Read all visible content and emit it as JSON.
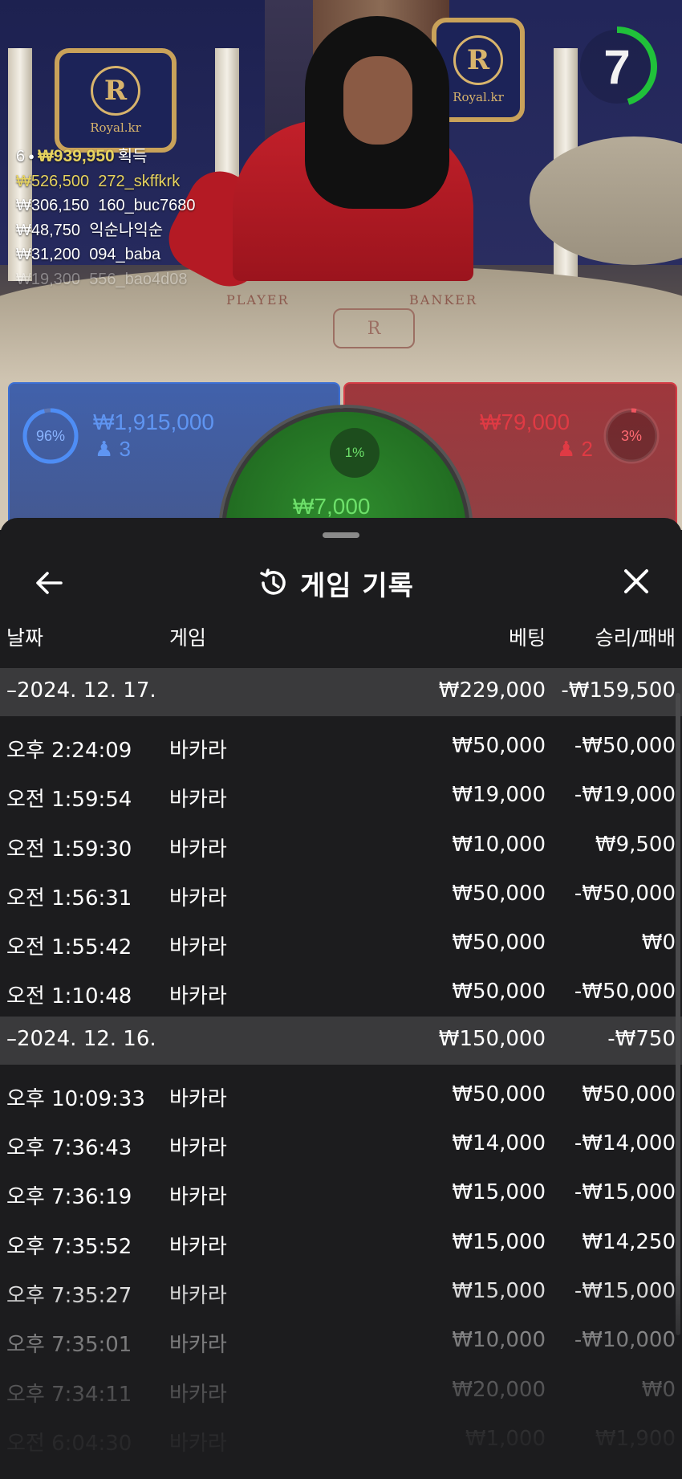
{
  "table": {
    "brand": "Royal.kr",
    "logo_letter": "R",
    "felt_player": "PLAYER",
    "felt_banker": "BANKER"
  },
  "timer": {
    "seconds": "7",
    "progress": 0.45
  },
  "winners": {
    "player_count": "6",
    "total_amount": "₩939,950",
    "total_suffix": "획득",
    "list": [
      {
        "amount": "₩526,500",
        "user": "272_skffkrk"
      },
      {
        "amount": "₩306,150",
        "user": "160_buc7680"
      },
      {
        "amount": "₩48,750",
        "user": "익순나익순"
      },
      {
        "amount": "₩31,200",
        "user": "094_baba"
      },
      {
        "amount": "₩19,300",
        "user": "556_bao4d08"
      }
    ]
  },
  "bets": {
    "player": {
      "percent": "96%",
      "amount": "₩1,915,000",
      "count": "3"
    },
    "banker": {
      "percent": "3%",
      "amount": "₩79,000",
      "count": "2"
    },
    "tie": {
      "percent": "1%",
      "amount": "₩7,000"
    }
  },
  "colors": {
    "player": "#3c6fd4",
    "banker": "#d63b45",
    "tie": "#2f8d2e",
    "winner_gold": "#e7d35f",
    "timer_green": "#20c13a"
  },
  "history": {
    "title": "게임 기록",
    "icons": {
      "back": "back-arrow-icon",
      "history": "history-icon",
      "close": "close-icon"
    },
    "columns": {
      "date": "날짜",
      "game": "게임",
      "bet": "베팅",
      "winloss": "승리/패배"
    },
    "groups": [
      {
        "date": "–2024. 12. 17.",
        "bet": "₩229,000",
        "winloss": "-₩159,500",
        "rows": [
          {
            "time": "오후 2:24:09",
            "game": "바카라",
            "bet": "₩50,000",
            "winloss": "-₩50,000"
          },
          {
            "time": "오전 1:59:54",
            "game": "바카라",
            "bet": "₩19,000",
            "winloss": "-₩19,000"
          },
          {
            "time": "오전 1:59:30",
            "game": "바카라",
            "bet": "₩10,000",
            "winloss": "₩9,500"
          },
          {
            "time": "오전 1:56:31",
            "game": "바카라",
            "bet": "₩50,000",
            "winloss": "-₩50,000"
          },
          {
            "time": "오전 1:55:42",
            "game": "바카라",
            "bet": "₩50,000",
            "winloss": "₩0"
          },
          {
            "time": "오전 1:10:48",
            "game": "바카라",
            "bet": "₩50,000",
            "winloss": "-₩50,000"
          }
        ]
      },
      {
        "date": "–2024. 12. 16.",
        "bet": "₩150,000",
        "winloss": "-₩750",
        "rows": [
          {
            "time": "오후 10:09:33",
            "game": "바카라",
            "bet": "₩50,000",
            "winloss": "₩50,000"
          },
          {
            "time": "오후 7:36:43",
            "game": "바카라",
            "bet": "₩14,000",
            "winloss": "-₩14,000"
          },
          {
            "time": "오후 7:36:19",
            "game": "바카라",
            "bet": "₩15,000",
            "winloss": "-₩15,000"
          },
          {
            "time": "오후 7:35:52",
            "game": "바카라",
            "bet": "₩15,000",
            "winloss": "₩14,250"
          },
          {
            "time": "오후 7:35:27",
            "game": "바카라",
            "bet": "₩15,000",
            "winloss": "-₩15,000"
          },
          {
            "time": "오후 7:35:01",
            "game": "바카라",
            "bet": "₩10,000",
            "winloss": "-₩10,000"
          },
          {
            "time": "오후 7:34:11",
            "game": "바카라",
            "bet": "₩20,000",
            "winloss": "₩0"
          },
          {
            "time": "오전 6:04:30",
            "game": "바카라",
            "bet": "₩1,000",
            "winloss": "₩1,900"
          }
        ]
      }
    ]
  }
}
